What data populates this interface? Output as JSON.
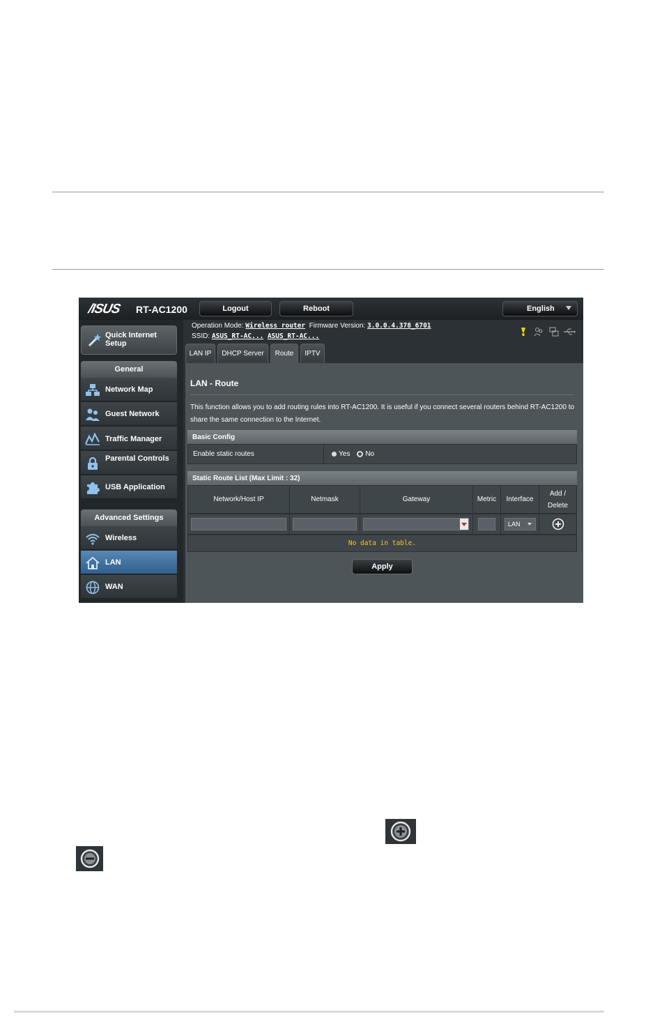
{
  "header": {
    "brand": "/ISUS",
    "model": "RT-AC1200",
    "logout_label": "Logout",
    "reboot_label": "Reboot",
    "language": "English"
  },
  "status": {
    "op_mode_label": "Operation Mode:",
    "op_mode_value": "Wireless router",
    "fw_label": "Firmware Version:",
    "fw_value": "3.0.0.4.378_6701",
    "ssid_label": "SSID:",
    "ssid_1": "ASUS_RT-AC...",
    "ssid_2": "ASUS_RT-AC..."
  },
  "sidebar": {
    "qis": "Quick Internet Setup",
    "general_title": "General",
    "general_items": [
      "Network Map",
      "Guest Network",
      "Traffic Manager",
      "Parental Controls",
      "USB Application"
    ],
    "advanced_title": "Advanced Settings",
    "advanced_items": [
      "Wireless",
      "LAN",
      "WAN"
    ]
  },
  "tabs": [
    "LAN IP",
    "DHCP Server",
    "Route",
    "IPTV"
  ],
  "panel": {
    "title": "LAN - Route",
    "description": "This function allows you to add routing rules into RT-AC1200. It is useful if you connect several routers behind RT-AC1200 to share the same connection to the Internet.",
    "basic_config": "Basic Config",
    "enable_label": "Enable static routes",
    "opt_yes": "Yes",
    "opt_no": "No",
    "selected_option": "No",
    "list_title": "Static Route List (Max Limit : 32)",
    "columns": [
      "Network/Host IP",
      "Netmask",
      "Gateway",
      "Metric",
      "Interface",
      "Add / Delete"
    ],
    "interface_value": "LAN",
    "empty_text": "No data in table.",
    "apply_label": "Apply"
  },
  "colors": {
    "accent_active": "#3b6d9c",
    "empty_text": "#f4c431"
  }
}
